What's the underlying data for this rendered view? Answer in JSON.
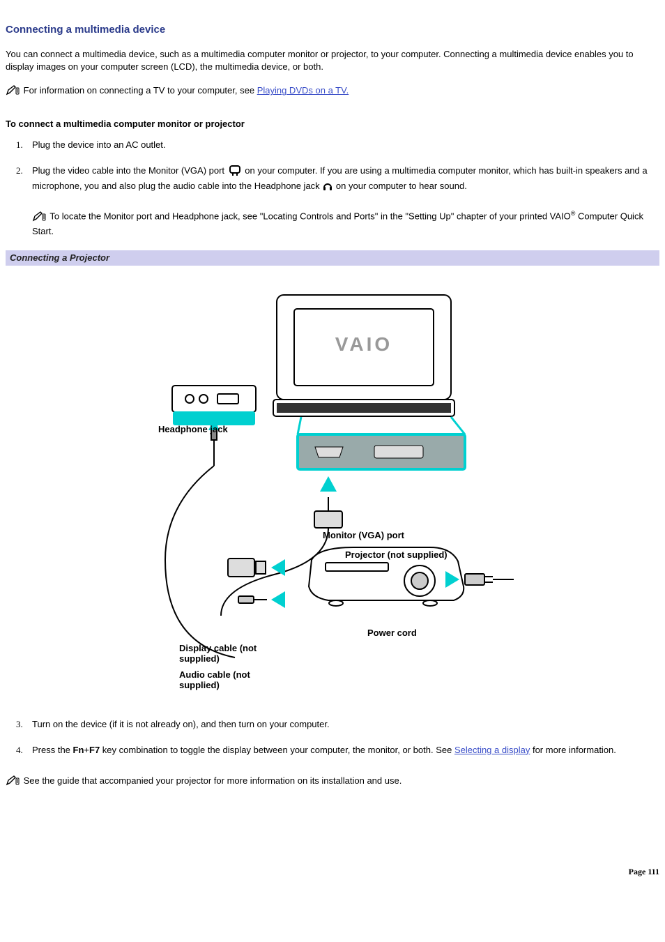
{
  "title": "Connecting a multimedia device",
  "intro": "You can connect a multimedia device, such as a multimedia computer monitor or projector, to your computer. Connecting a multimedia device enables you to display images on your computer screen (LCD), the multimedia device, or both.",
  "tvnote_prefix": "For information on connecting a TV to your computer, see ",
  "tvnote_link": "Playing DVDs on a TV.",
  "subhead": "To connect a multimedia computer monitor or projector",
  "steps": {
    "s1": "Plug the device into an AC outlet.",
    "s2a": "Plug the video cable into the Monitor (VGA) port ",
    "s2b": " on your computer. If you are using a multimedia computer monitor, which has built-in speakers and a microphone, you and also plug the audio cable into the Headphone jack ",
    "s2c": " on your computer to hear sound.",
    "s2_note_a": "To locate the Monitor port and Headphone jack, see \"Locating Controls and Ports\" in the \"Setting Up\" chapter of your printed VAIO",
    "s2_note_b": " Computer Quick Start.",
    "s3": "Turn on the device (if it is not already on), and then turn on your computer.",
    "s4a": "Press the ",
    "s4_fn": "Fn",
    "s4_plus": "+",
    "s4_f7": "F7",
    "s4b": " key combination to toggle the display between your computer, the monitor, or both. See ",
    "s4_link": "Selecting a display",
    "s4c": " for more information."
  },
  "figure_caption": "Connecting a Projector",
  "figure_labels": {
    "headphone": "Headphone jack",
    "vga": "Monitor (VGA) port",
    "projector": "Projector (not supplied)",
    "power": "Power cord",
    "display_cable": "Display cable (not supplied)",
    "audio_cable": "Audio cable (not supplied)"
  },
  "endnote": "See the guide that accompanied your projector for more information on its installation and use.",
  "page": "Page 111"
}
